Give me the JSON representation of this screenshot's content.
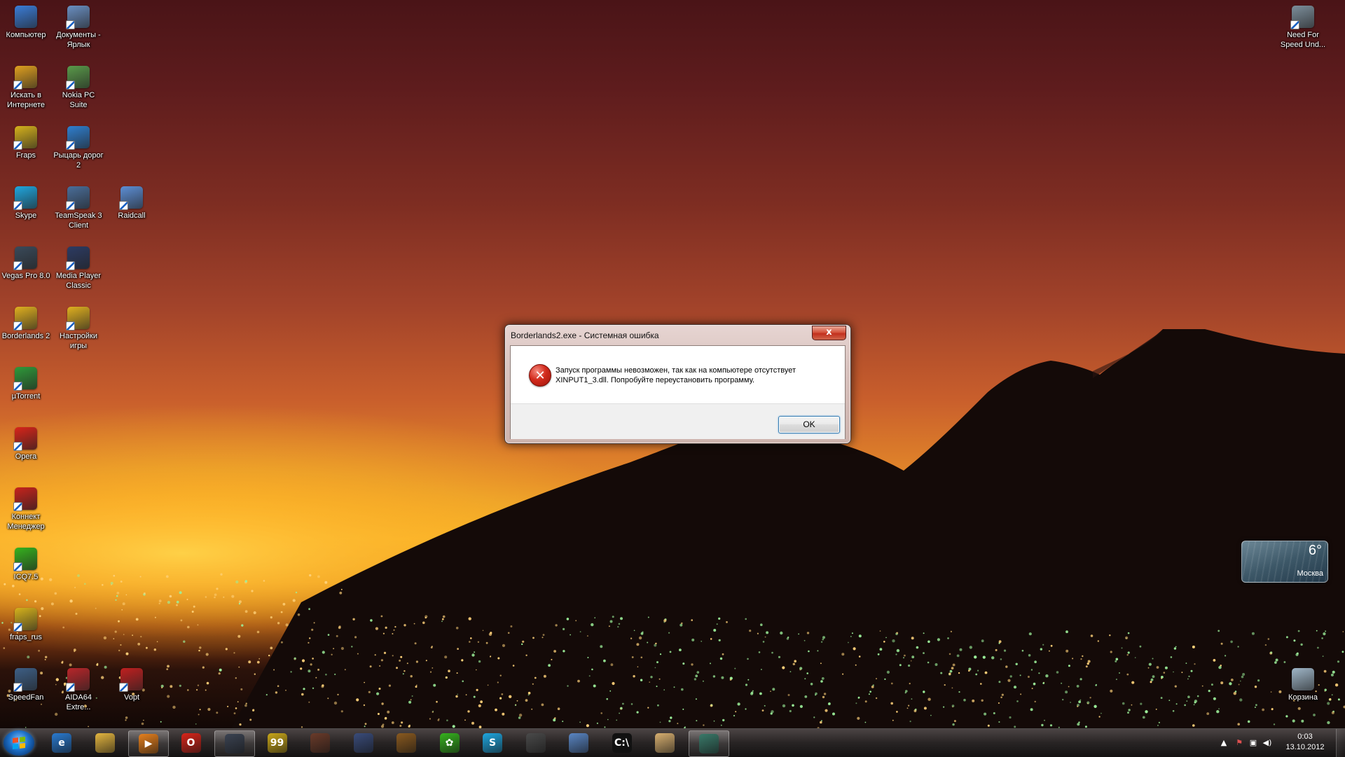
{
  "desktop_icons": [
    {
      "label": "Компьютер",
      "icon": "computer-icon",
      "color": "#3b7dd8"
    },
    {
      "label": "Документы - Ярлык",
      "icon": "documents-icon",
      "color": "#6a8fc2"
    },
    {
      "label": "Искать в Интернете",
      "icon": "internet-search-icon",
      "color": "#e0a020"
    },
    {
      "label": "Nokia PC Suite",
      "icon": "nokia-pc-suite-icon",
      "color": "#5a9a4a"
    },
    {
      "label": "Fraps",
      "icon": "fraps-icon",
      "color": "#d6b21c"
    },
    {
      "label": "Рыцарь дорог 2",
      "icon": "knight-of-roads-icon",
      "color": "#2f7fd0"
    },
    {
      "label": "Skype",
      "icon": "skype-icon",
      "color": "#1fa7e0"
    },
    {
      "label": "TeamSpeak 3 Client",
      "icon": "teamspeak-icon",
      "color": "#4a6e9a"
    },
    {
      "label": "Raidcall",
      "icon": "raidcall-icon",
      "color": "#5d8fd6"
    },
    {
      "label": "Vegas Pro 8.0",
      "icon": "vegas-pro-icon",
      "color": "#3a4a5a"
    },
    {
      "label": "Media Player Classic",
      "icon": "media-player-classic-icon",
      "color": "#2c3b63"
    },
    {
      "label": "Borderlands 2",
      "icon": "borderlands-icon",
      "color": "#e0b020"
    },
    {
      "label": "Настройки игры",
      "icon": "game-settings-icon",
      "color": "#e0b020"
    },
    {
      "label": "µTorrent",
      "icon": "utorrent-icon",
      "color": "#2f9a3a"
    },
    {
      "label": "Opera",
      "icon": "opera-icon",
      "color": "#d9251a"
    },
    {
      "label": "Коннект Менеджер",
      "icon": "connect-manager-icon",
      "color": "#c8231c"
    },
    {
      "label": "ICQ7.5",
      "icon": "icq-icon",
      "color": "#36b31e"
    },
    {
      "label": "fraps_rus",
      "icon": "fraps-rus-icon",
      "color": "#d6b21c"
    },
    {
      "label": "SpeedFan",
      "icon": "speedfan-icon",
      "color": "#3d5f86"
    },
    {
      "label": "AIDA64 Extre...",
      "icon": "aida64-icon",
      "color": "#b8262a"
    },
    {
      "label": "Vopt",
      "icon": "vopt-icon",
      "color": "#c02020"
    },
    {
      "label": "Need For Speed Und...",
      "icon": "need-for-speed-icon",
      "color": "#7d8f9c"
    },
    {
      "label": "Корзина",
      "icon": "recycle-bin-icon",
      "color": "#9fb6c8"
    }
  ],
  "weather": {
    "temperature": "6°",
    "city": "Москва"
  },
  "dialog": {
    "title": "Borderlands2.exe - Системная ошибка",
    "close_label": "x",
    "message": "Запуск программы невозможен, так как на компьютере отсутствует XINPUT1_3.dll. Попробуйте переустановить программу.",
    "ok_label": "OK"
  },
  "taskbar": {
    "items": [
      {
        "icon": "internet-explorer-icon",
        "color": "#2a7ad0",
        "glyph": "e",
        "active": false
      },
      {
        "icon": "explorer-folder-icon",
        "color": "#e4b640",
        "glyph": "",
        "active": false
      },
      {
        "icon": "media-player-icon",
        "color": "#e6801e",
        "glyph": "▶",
        "active": true
      },
      {
        "icon": "opera-icon",
        "color": "#d9251a",
        "glyph": "O",
        "active": false
      },
      {
        "icon": "steam-icon",
        "color": "#3b4352",
        "glyph": "",
        "active": true
      },
      {
        "icon": "fraps-icon",
        "color": "#c9a719",
        "glyph": "99",
        "active": false
      },
      {
        "icon": "game-icon",
        "color": "#6a3b2a",
        "glyph": "",
        "active": false
      },
      {
        "icon": "unreal-icon",
        "color": "#3a4c7a",
        "glyph": "",
        "active": false
      },
      {
        "icon": "winged-emblem-icon",
        "color": "#8a5a20",
        "glyph": "",
        "active": false
      },
      {
        "icon": "icq-icon",
        "color": "#36b31e",
        "glyph": "✿",
        "active": false
      },
      {
        "icon": "skype-icon",
        "color": "#1fa7e0",
        "glyph": "S",
        "active": false
      },
      {
        "icon": "settings-icon",
        "color": "#4a4a4a",
        "glyph": "",
        "active": false
      },
      {
        "icon": "teamspeak-icon",
        "color": "#5a86c4",
        "glyph": "",
        "active": false
      },
      {
        "icon": "command-prompt-icon",
        "color": "#111111",
        "glyph": "C:\\",
        "active": false
      },
      {
        "icon": "character-portrait-icon",
        "color": "#d8b070",
        "glyph": "",
        "active": false
      },
      {
        "icon": "window-icon",
        "color": "#3a7a6a",
        "glyph": "",
        "active": true
      }
    ],
    "clock_time": "0:03",
    "clock_date": "13.10.2012"
  }
}
